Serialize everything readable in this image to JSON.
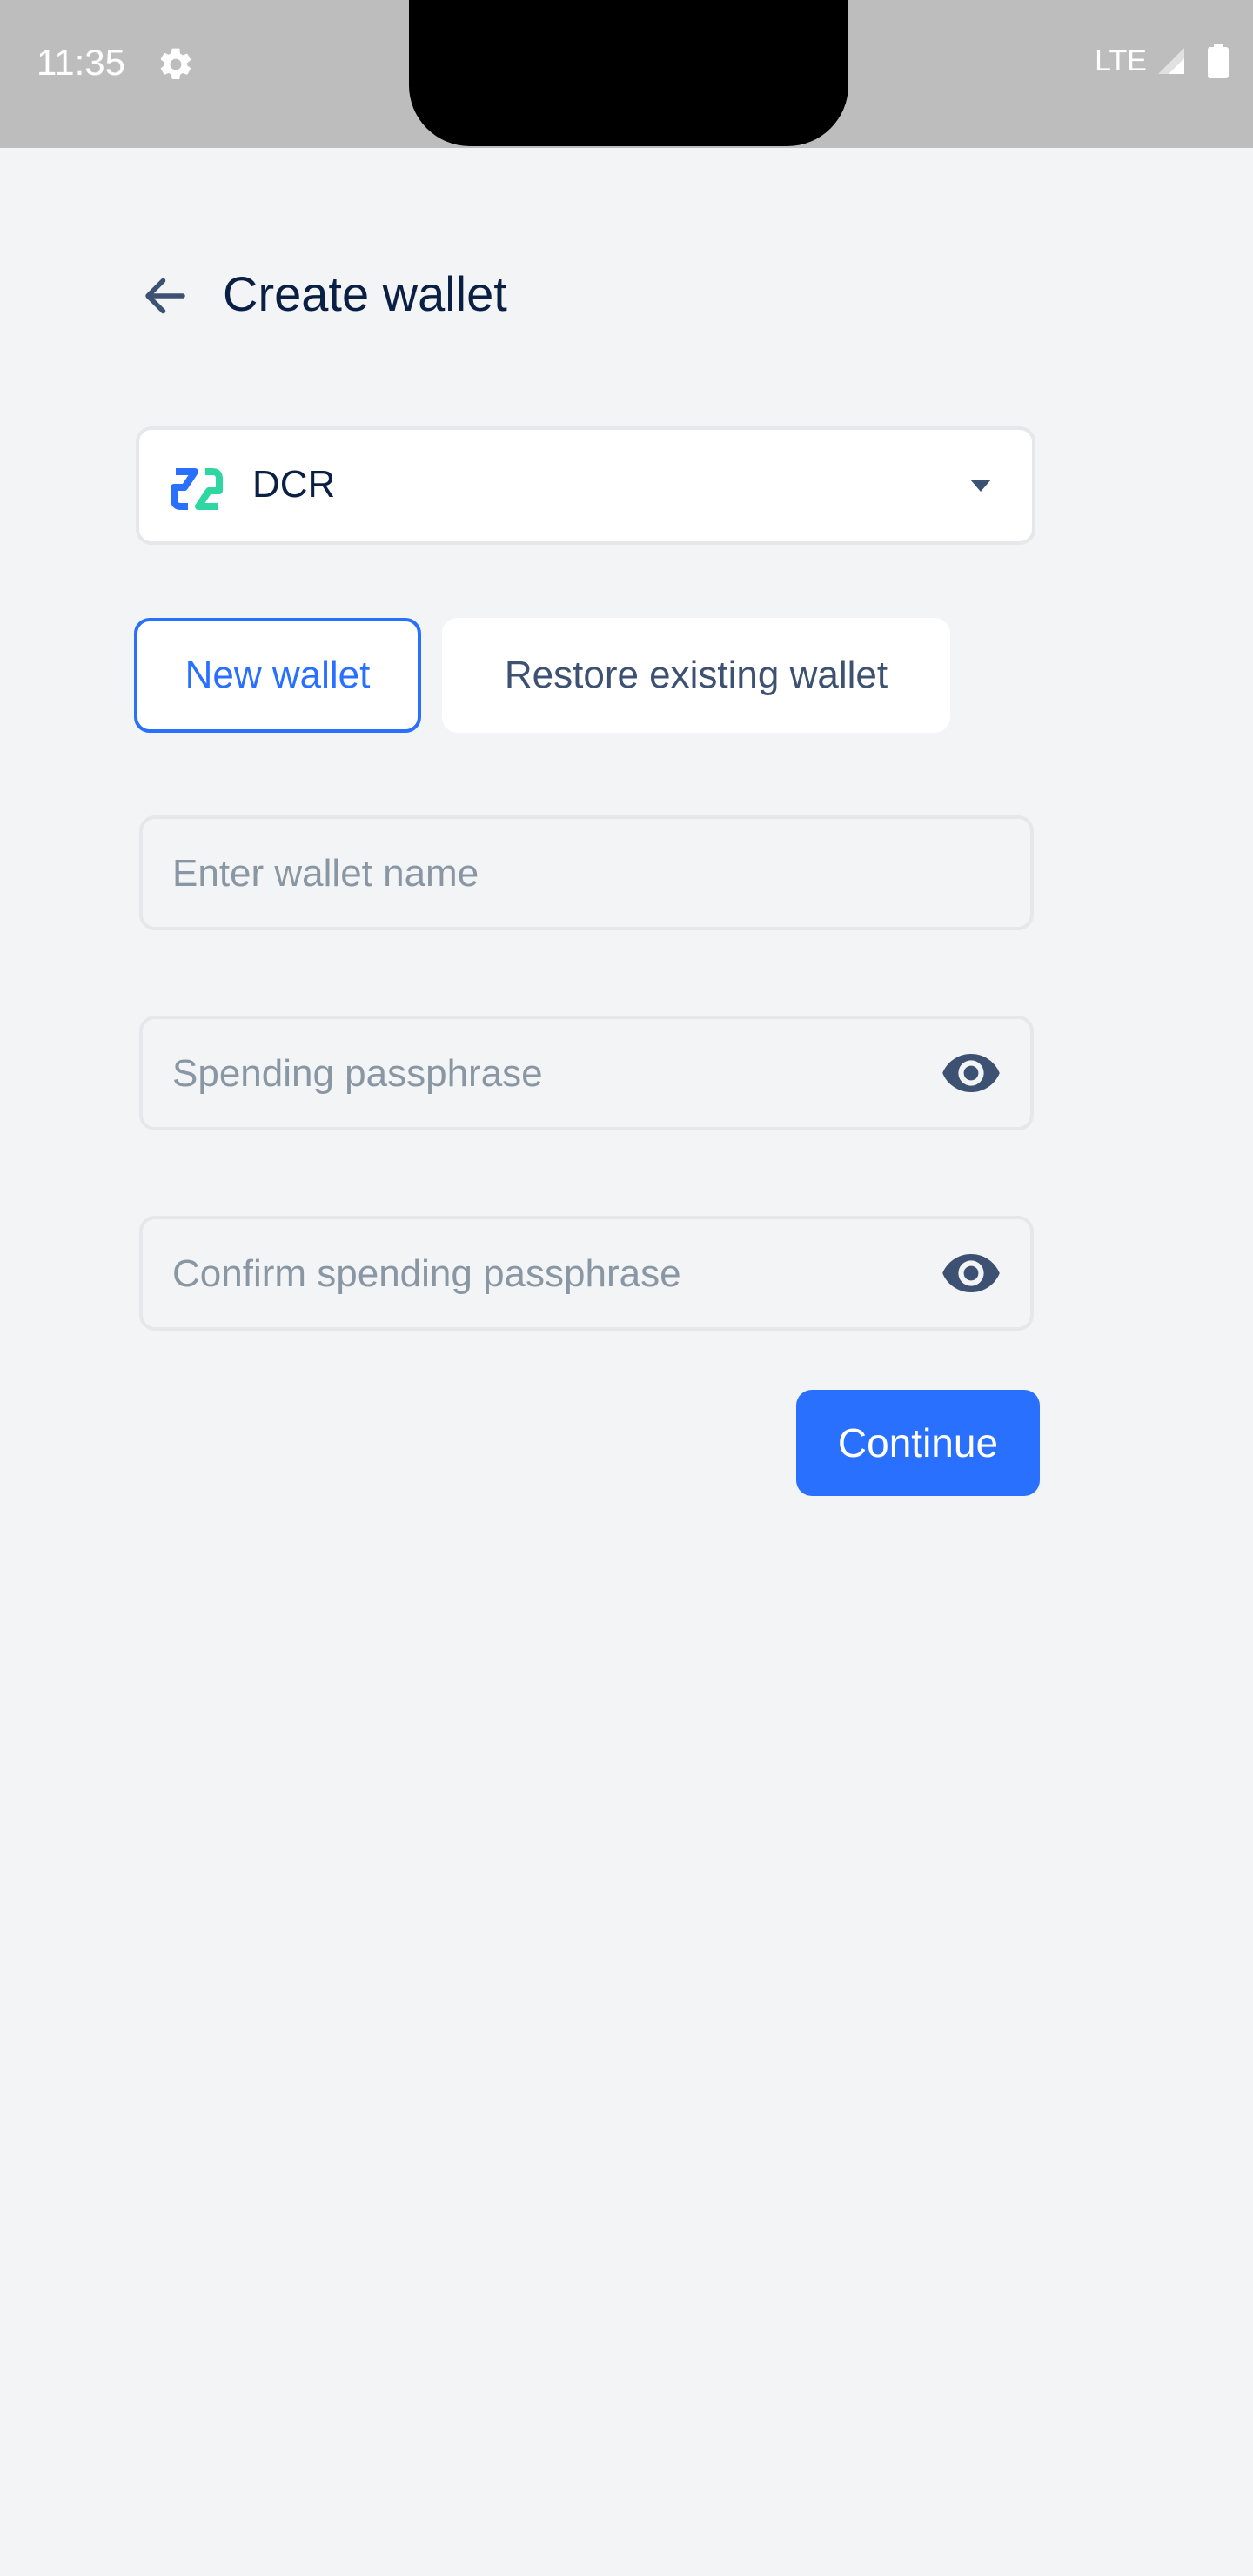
{
  "status_bar": {
    "time": "11:35",
    "network": "LTE"
  },
  "header": {
    "title": "Create wallet"
  },
  "currency_select": {
    "selected": "DCR"
  },
  "tabs": [
    {
      "label": "New wallet",
      "active": true
    },
    {
      "label": "Restore existing wallet",
      "active": false
    }
  ],
  "form": {
    "wallet_name_placeholder": "Enter wallet name",
    "wallet_name_value": "",
    "passphrase_placeholder": "Spending passphrase",
    "passphrase_value": "",
    "confirm_placeholder": "Confirm spending passphrase",
    "confirm_value": ""
  },
  "actions": {
    "continue_label": "Continue"
  },
  "colors": {
    "accent": "#2970ff",
    "title": "#0a1f44",
    "background": "#f3f4f6",
    "placeholder": "#8997a5"
  },
  "icons": {
    "back": "arrow-left-icon",
    "settings": "gear-icon",
    "currency": "dcr-icon",
    "dropdown": "caret-down-icon",
    "visibility": "eye-icon"
  }
}
